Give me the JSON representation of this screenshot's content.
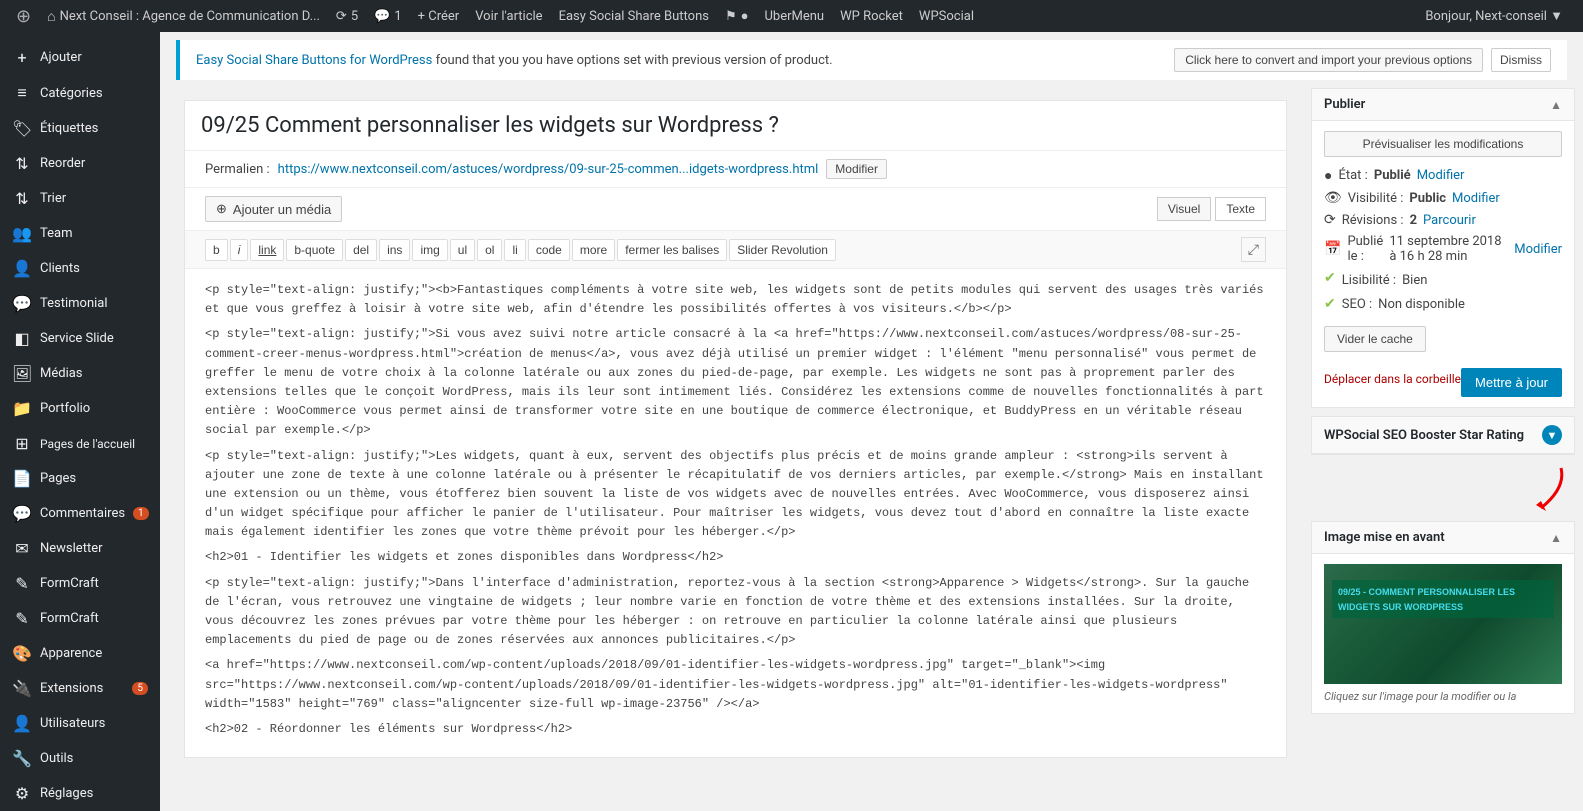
{
  "adminbar": {
    "wp_logo": "⊕",
    "site_name": "Next Conseil : Agence de Communication D...",
    "updates_count": "5",
    "comments_count": "1",
    "creer_label": "+ Créer",
    "voir_article_label": "Voir l'article",
    "easy_social_label": "Easy Social Share Buttons",
    "ubermenu_label": "UberMenu",
    "wp_rocket_label": "WP Rocket",
    "wpsocial_label": "WPSocial",
    "bonjour": "Bonjour, Next-conseil ▼"
  },
  "sidebar": {
    "items": [
      {
        "id": "ajouter",
        "label": "Ajouter",
        "icon": "+"
      },
      {
        "id": "categories",
        "label": "Catégories",
        "icon": "≡"
      },
      {
        "id": "etiquettes",
        "label": "Étiquettes",
        "icon": "🏷"
      },
      {
        "id": "reorder",
        "label": "Reorder",
        "icon": "⇅"
      },
      {
        "id": "trier",
        "label": "Trier",
        "icon": "⇅"
      },
      {
        "id": "team",
        "label": "Team",
        "icon": "👥"
      },
      {
        "id": "clients",
        "label": "Clients",
        "icon": "👤"
      },
      {
        "id": "testimonial",
        "label": "Testimonial",
        "icon": "💬"
      },
      {
        "id": "service-slide",
        "label": "Service Slide",
        "icon": "◧"
      },
      {
        "id": "medias",
        "label": "Médias",
        "icon": "🖼"
      },
      {
        "id": "portfolio",
        "label": "Portfolio",
        "icon": "📁"
      },
      {
        "id": "pages-accueil",
        "label": "Pages de l'accueil",
        "icon": "⊞"
      },
      {
        "id": "pages",
        "label": "Pages",
        "icon": "📄"
      },
      {
        "id": "commentaires",
        "label": "Commentaires",
        "icon": "💬",
        "badge": "1"
      },
      {
        "id": "newsletter",
        "label": "Newsletter",
        "icon": "✉"
      },
      {
        "id": "formcraft1",
        "label": "FormCraft",
        "icon": "✎"
      },
      {
        "id": "formcraft2",
        "label": "FormCraft",
        "icon": "✎"
      },
      {
        "id": "apparence",
        "label": "Apparence",
        "icon": "🎨"
      },
      {
        "id": "extensions",
        "label": "Extensions",
        "icon": "🔌",
        "badge": "5"
      },
      {
        "id": "utilisateurs",
        "label": "Utilisateurs",
        "icon": "👤"
      },
      {
        "id": "outils",
        "label": "Outils",
        "icon": "🔧"
      },
      {
        "id": "reglages",
        "label": "Réglages",
        "icon": "⚙"
      }
    ]
  },
  "notification": {
    "plugin_name": "Easy Social Share Buttons for WordPress",
    "message": " found that you you have options set with previous version of product.",
    "convert_btn": "Click here to convert and import your previous options",
    "dismiss_btn": "Dismiss"
  },
  "post": {
    "title": "09/25 Comment personnaliser les widgets sur Wordpress ?",
    "permalink_label": "Permalien :",
    "permalink_url": "https://www.nextconseil.com/astuces/wordpress/09-sur-25-commen...idgets-wordpress.html",
    "modifier_btn": "Modifier",
    "add_media_btn": "Ajouter un média",
    "view_visual": "Visuel",
    "view_text": "Texte"
  },
  "toolbar": {
    "buttons": [
      "b",
      "i",
      "link",
      "b-quote",
      "del",
      "ins",
      "img",
      "ul",
      "ol",
      "li",
      "code",
      "more",
      "fermer les balises",
      "Slider Revolution"
    ]
  },
  "content": {
    "html": "<p style=\"text-align: justify;\"><b>Fantastiques compléments à votre site web, les widgets sont de petits modules qui servent des usages très variés et que vous greffez à loisir à votre site web, afin d'étendre les possibilités offertes à vos visiteurs.</b></p>\n<p style=\"text-align: justify;\">Si vous avez suivi notre article consacré à la <a href=\"https://www.nextconseil.com/astuces/wordpress/08-sur-25-comment-creer-menus-wordpress.html\">création de menus</a>, vous avez déjà utilisé un premier widget : l'élément \"menu personnalisé\" vous permet de greffer le menu de votre choix à la colonne latérale ou aux zones du pied-de-page, par exemple. Les widgets ne sont pas à proprement parler des extensions telles que le conçoit WordPress, mais ils leur sont intimement liés. Considérez les extensions comme de nouvelles fonctionnalités à part entière : WooCommerce vous permet ainsi de transformer votre site en une boutique de commerce électronique, et BuddyPress en un véritable réseau social par exemple.</p>\n<p style=\"text-align: justify;\">Les widgets, quant à eux, servent des objectifs plus précis et de moins grande ampleur : <strong>ils servent à ajouter une zone de texte à une colonne latérale ou à présenter le récapitulatif de vos derniers articles, par exemple.</strong> Mais en installant une extension ou un thème, vous étofferez bien souvent la liste de vos widgets avec de nouvelles entrées. Avec WooCommerce, vous disposerez ainsi d'un widget spécifique pour afficher le panier de l'utilisateur. Pour maîtriser les widgets, vous devez tout d'abord en connaître la liste exacte mais également identifier les zones que votre thème prévoit pour les héberger.</p>\n\n<h2>01 - Identifier les widgets et zones disponibles dans Wordpress</h2>\n\n<p style=\"text-align: justify;\">Dans l'interface d'administration, reportez-vous à la section <strong>Apparence > Widgets</strong>. Sur la gauche de l'écran, vous retrouvez une vingtaine de widgets ; leur nombre varie en fonction de votre thème et des extensions installées. Sur la droite, vous découvrez les zones prévues par votre thème pour les héberger : on retrouve en particulier la colonne latérale ainsi que plusieurs emplacements du pied de page ou de zones réservées aux annonces publicitaires.</p>\n<a href=\"https://www.nextconseil.com/wp-content/uploads/2018/09/01-identifier-les-widgets-wordpress.jpg\" target=\"_blank\"><img src=\"https://www.nextconseil.com/wp-content/uploads/2018/09/01-identifier-les-widgets-wordpress.jpg\" alt=\"01-identifier-les-widgets-wordpress\" width=\"1583\" height=\"769\" class=\"aligncenter size-full wp-image-23756\" /></a>\n\n<h2>02 - Réordonner les éléments sur Wordpress</h2>"
  },
  "publish_box": {
    "title": "Publier",
    "preview_btn": "Prévisualiser les modifications",
    "state_label": "État :",
    "state_value": "Publié",
    "state_modifier": "Modifier",
    "visibility_label": "Visibilité :",
    "visibility_value": "Public",
    "visibility_modifier": "Modifier",
    "revisions_label": "Révisions :",
    "revisions_value": "2",
    "revisions_link": "Parcourir",
    "published_label": "Publié le :",
    "published_value": "11 septembre 2018 à 16 h 28 min",
    "published_modifier": "Modifier",
    "lisibilite_label": "Lisibilité :",
    "lisibilite_value": "Bien",
    "seo_label": "SEO :",
    "seo_value": "Non disponible",
    "vider_cache_btn": "Vider le cache",
    "deplacer_corbeille": "Déplacer dans la corbeille",
    "mettre_jour_btn": "Mettre à jour"
  },
  "wpsocial_box": {
    "title": "WPSocial SEO Booster Star Rating"
  },
  "featured_image_box": {
    "title": "Image mise en avant",
    "caption": "Cliquez sur l'image pour la modifier ou la",
    "overlay_title": "09/25 - COMMENT PERSONNALISER LES WIDGETS SUR WORDPRESS"
  }
}
